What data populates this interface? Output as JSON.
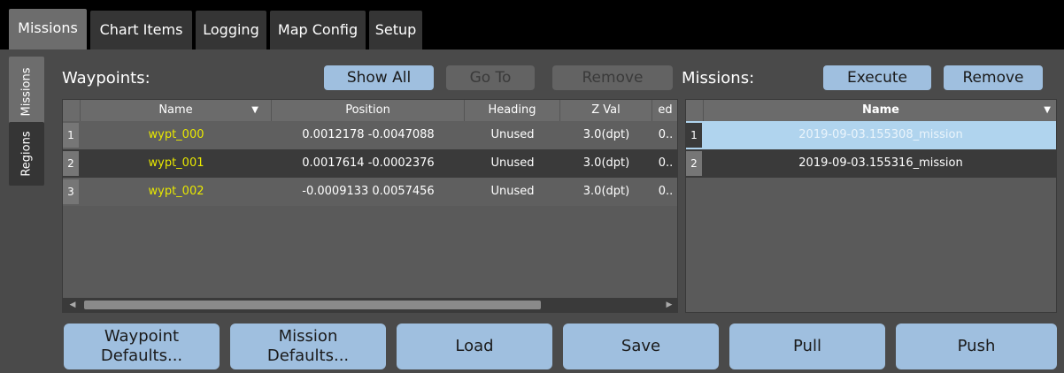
{
  "tabs": [
    "Missions",
    "Chart Items",
    "Logging",
    "Map Config",
    "Setup"
  ],
  "side_tabs": [
    "Missions",
    "Regions"
  ],
  "waypoints": {
    "label": "Waypoints:",
    "show_all": "Show All",
    "go_to": "Go To",
    "remove": "Remove",
    "columns": [
      "Name",
      "Position",
      "Heading",
      "Z Val",
      "ed"
    ],
    "rows": [
      {
        "num": "1",
        "name": "wypt_000",
        "position": "0.0012178 -0.0047088",
        "heading": "Unused",
        "zval": "3.0(dpt)",
        "extra": "0.."
      },
      {
        "num": "2",
        "name": "wypt_001",
        "position": "0.0017614 -0.0002376",
        "heading": "Unused",
        "zval": "3.0(dpt)",
        "extra": "0.."
      },
      {
        "num": "3",
        "name": "wypt_002",
        "position": "-0.0009133 0.0057456",
        "heading": "Unused",
        "zval": "3.0(dpt)",
        "extra": "0.."
      }
    ]
  },
  "missions": {
    "label": "Missions:",
    "execute": "Execute",
    "remove": "Remove",
    "column": "Name",
    "rows": [
      {
        "num": "1",
        "name": "2019-09-03.155308_mission",
        "selected": true
      },
      {
        "num": "2",
        "name": "2019-09-03.155316_mission",
        "selected": false
      }
    ]
  },
  "bottom": {
    "waypoint_defaults_1": "Waypoint",
    "waypoint_defaults_2": "Defaults...",
    "mission_defaults_1": "Mission",
    "mission_defaults_2": "Defaults...",
    "load": "Load",
    "save": "Save",
    "pull": "Pull",
    "push": "Push"
  },
  "colors": {
    "accent": "#9fbfdf",
    "waypoint_name": "#e8e800",
    "selected_row": "#b0d4ee"
  }
}
